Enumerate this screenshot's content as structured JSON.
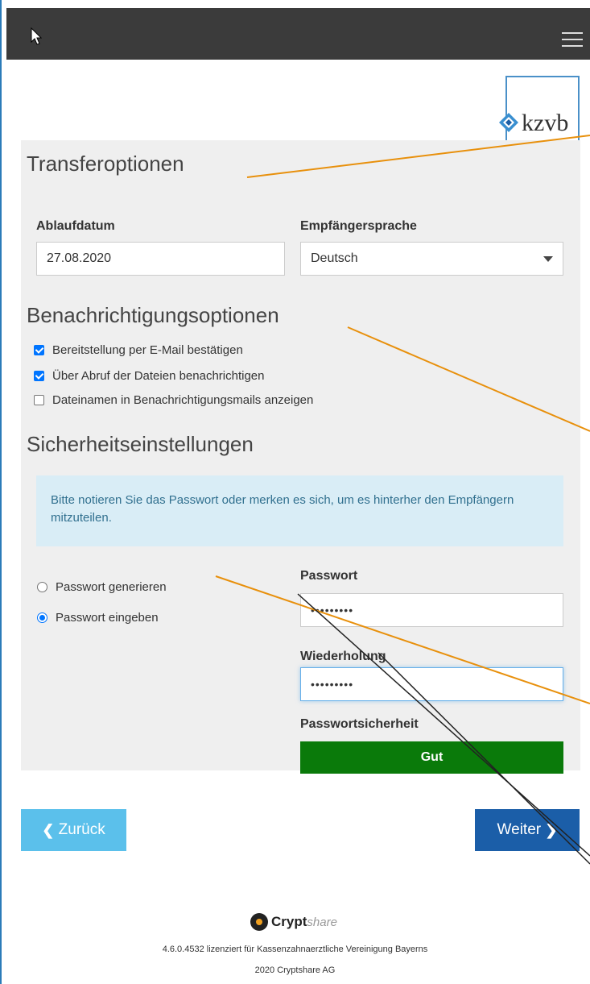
{
  "header": {
    "menu_icon": "hamburger-menu-icon",
    "cursor_icon": "mouse-pointer-icon"
  },
  "logo": {
    "text": "kzvb",
    "border_color": "#4a90c8"
  },
  "transfer": {
    "title": "Transferoptionen",
    "expiry_label": "Ablaufdatum",
    "expiry_value": "27.08.2020",
    "language_label": "Empfängersprache",
    "language_value": "Deutsch"
  },
  "notification": {
    "title": "Benachrichtigungsoptionen",
    "options": [
      {
        "label": "Bereitstellung per E-Mail bestätigen",
        "checked": true
      },
      {
        "label": "Über Abruf der Dateien benachrichtigen",
        "checked": true
      },
      {
        "label": "Dateinamen in Benachrichtigungsmails anzeigen",
        "checked": false
      }
    ]
  },
  "security": {
    "title": "Sicherheitseinstellungen",
    "info": "Bitte notieren Sie das Passwort oder merken es sich, um es hinterher den Empfängern mitzuteilen.",
    "radio_generate": "Passwort generieren",
    "radio_enter": "Passwort eingeben",
    "selected": "enter",
    "password_label": "Passwort",
    "password_value": "•••••••••",
    "repeat_label": "Wiederholung",
    "repeat_value": "•••••••••",
    "strength_label": "Passwortsicherheit",
    "strength_value": "Gut",
    "strength_color": "#0a7a0a"
  },
  "nav": {
    "back_label": "Zurück",
    "next_label": "Weiter",
    "back_color": "#5bc0eb",
    "next_color": "#1b5ea8"
  },
  "footer": {
    "brand_bold": "Crypt",
    "brand_light": "share",
    "license": "4.6.0.4532 lizenziert für Kassenzahnaerztliche Vereinigung Bayerns",
    "copyright": "2020 Cryptshare AG"
  },
  "annotation_colors": {
    "orange": "#e8900c",
    "black": "#222222"
  }
}
